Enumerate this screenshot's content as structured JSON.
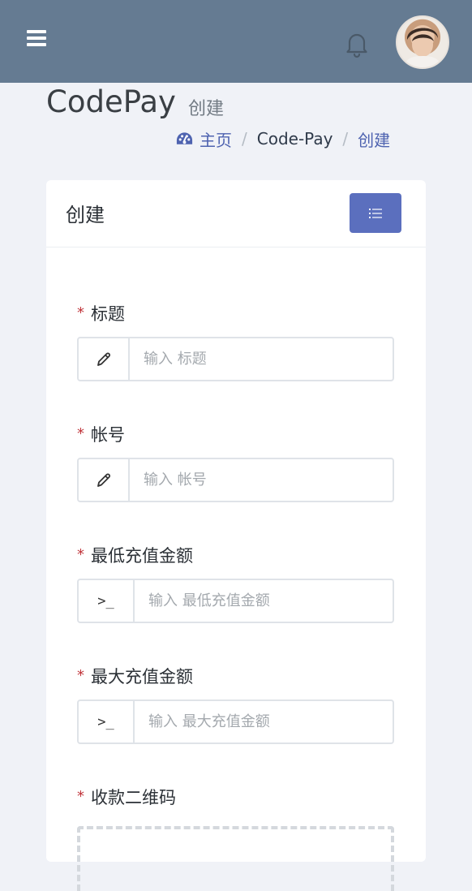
{
  "header": {
    "menu_icon": "hamburger-menu-icon",
    "bell_icon": "bell-icon",
    "avatar": "user-avatar"
  },
  "page": {
    "title": "CodePay",
    "subtitle": "创建"
  },
  "breadcrumb": {
    "home": "主页",
    "section": "Code-Pay",
    "current": "创建",
    "separator": "/"
  },
  "card": {
    "title": "创建",
    "list_button_icon": "list-icon"
  },
  "form": {
    "fields": [
      {
        "label": "标题",
        "placeholder": "输入 标题",
        "value": "",
        "addon": "pencil-icon"
      },
      {
        "label": "帐号",
        "placeholder": "输入 帐号",
        "value": "",
        "addon": "pencil-icon"
      },
      {
        "label": "最低充值金额",
        "placeholder": "输入 最低充值金额",
        "value": "",
        "addon": ">_"
      },
      {
        "label": "最大充值金额",
        "placeholder": "输入 最大充值金额",
        "value": "",
        "addon": ">_"
      }
    ],
    "upload_label": "收款二维码",
    "required_mark": "*"
  },
  "colors": {
    "topbar": "#657b92",
    "accent": "#5b6fbe",
    "link": "#4e63b0",
    "required": "#c0343a"
  }
}
